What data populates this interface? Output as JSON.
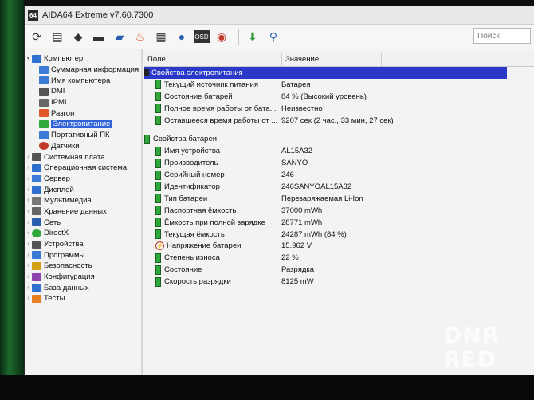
{
  "window": {
    "title": "AIDA64 Extreme v7.60.7300",
    "app_icon_text": "64"
  },
  "toolbar": {
    "buttons": [
      "refresh-icon",
      "report-icon",
      "motherboard-icon",
      "monitor-icon",
      "network-icon",
      "flame-icon",
      "cpu-icon",
      "user-icon",
      "osd-icon",
      "gauge-icon",
      "download-icon",
      "search-icon"
    ],
    "osd_label": "OSD",
    "search_placeholder": "Поиск"
  },
  "tree": {
    "root": "Компьютер",
    "children": [
      "Суммарная информация",
      "Имя компьютера",
      "DMI",
      "IPMI",
      "Разгон",
      "Электропитание",
      "Портативный ПК",
      "Датчики"
    ],
    "categories": [
      "Системная плата",
      "Операционная система",
      "Сервер",
      "Дисплей",
      "Мультимедиа",
      "Хранение данных",
      "Сеть",
      "DirectX",
      "Устройства",
      "Программы",
      "Безопасность",
      "Конфигурация",
      "База данных",
      "Тесты"
    ],
    "selected": "Электропитание"
  },
  "grid": {
    "col_field": "Поле",
    "col_value": "Значение",
    "section1": {
      "title": "Свойства электропитания",
      "rows": [
        {
          "field": "Текущий источник питания",
          "value": "Батарея"
        },
        {
          "field": "Состояние батарей",
          "value": "84 % (Высокий уровень)"
        },
        {
          "field": "Полное время работы от бата...",
          "value": "Неизвестно"
        },
        {
          "field": "Оставшееся время работы от ...",
          "value": "9207 сек (2 час., 33 мин, 27 сек)"
        }
      ]
    },
    "section2": {
      "title": "Свойства батареи",
      "rows": [
        {
          "field": "Имя устройства",
          "value": "AL15A32"
        },
        {
          "field": "Производитель",
          "value": "SANYO"
        },
        {
          "field": "Серийный номер",
          "value": "246"
        },
        {
          "field": "Идентификатор",
          "value": "246SANYOAL15A32"
        },
        {
          "field": "Тип батареи",
          "value": "Перезаряжаемая Li-Ion"
        },
        {
          "field": "Паспортная ёмкость",
          "value": "37000 mWh"
        },
        {
          "field": "Ёмкость при полной зарядке",
          "value": "28771 mWh"
        },
        {
          "field": "Текущая ёмкость",
          "value": "24287 mWh  (84 %)"
        },
        {
          "field": "Напряжение батареи",
          "value": "15.962 V"
        },
        {
          "field": "Степень износа",
          "value": "22 %"
        },
        {
          "field": "Состояние",
          "value": "Разрядка"
        },
        {
          "field": "Скорость разрядки",
          "value": "8125 mW"
        }
      ]
    }
  },
  "watermark": {
    "line1": "DNR",
    "line2": "RED"
  }
}
